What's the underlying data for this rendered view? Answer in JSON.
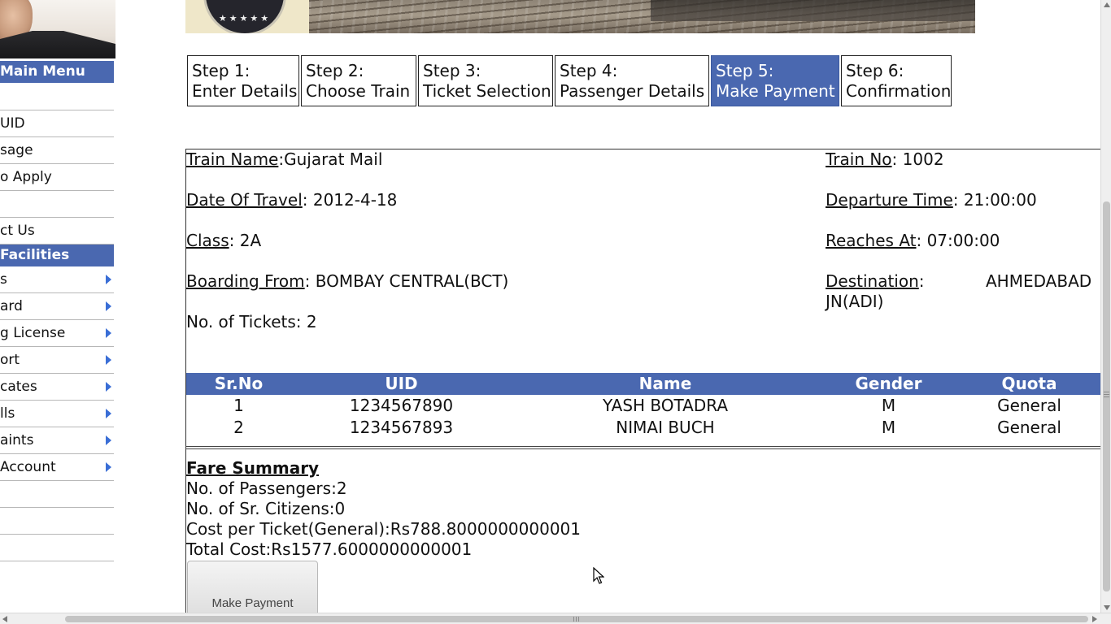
{
  "sidebar": {
    "main_menu_title": "Main Menu",
    "main_items": [
      {
        "label": ""
      },
      {
        "label": "UID"
      },
      {
        "label": "sage"
      },
      {
        "label": "o Apply"
      },
      {
        "label": ""
      },
      {
        "label": "ct Us"
      }
    ],
    "facilities_title": " Facilities",
    "facility_items": [
      {
        "label": "s"
      },
      {
        "label": "ard"
      },
      {
        "label": "g License"
      },
      {
        "label": "ort"
      },
      {
        "label": "cates"
      },
      {
        "label": "lls"
      },
      {
        "label": "aints"
      },
      {
        "label": " Account"
      },
      {
        "label": ""
      },
      {
        "label": ""
      },
      {
        "label": ""
      }
    ]
  },
  "steps": [
    {
      "number": "Step 1:",
      "label": "Enter Details"
    },
    {
      "number": "Step 2:",
      "label": "Choose Train"
    },
    {
      "number": "Step 3:",
      "label": "Ticket Selection"
    },
    {
      "number": "Step 4:",
      "label": "Passenger Details"
    },
    {
      "number": "Step 5:",
      "label": "Make Payment"
    },
    {
      "number": "Step 6:",
      "label": "Confirmation"
    }
  ],
  "details": {
    "train_name_label": "Train Name",
    "train_name_value": ":Gujarat Mail",
    "train_no_label": "Train No",
    "train_no_value": ": 1002",
    "date_label": "Date Of Travel",
    "date_value": ": 2012-4-18",
    "departure_label": "Departure Time",
    "departure_value": ": 21:00:00",
    "class_label": "Class",
    "class_value": ": 2A",
    "reaches_label": "Reaches At",
    "reaches_value": ": 07:00:00",
    "boarding_label": "Boarding From",
    "boarding_value": ": BOMBAY CENTRAL(BCT)",
    "destination_label": "Destination",
    "destination_colon": ":",
    "destination_value_1": "AHMEDABAD",
    "destination_value_2": "JN(ADI)",
    "tickets_text": "No. of Tickets: 2"
  },
  "passenger_table": {
    "headers": [
      "Sr.No",
      "UID",
      "Name",
      "Gender",
      "Quota"
    ],
    "rows": [
      [
        "1",
        "1234567890",
        "YASH BOTADRA",
        "M",
        "General"
      ],
      [
        "2",
        "1234567893",
        "NIMAI BUCH",
        "M",
        "General"
      ]
    ]
  },
  "fare": {
    "title": "Fare Summary",
    "passengers": "No. of Passengers:2",
    "sr_citizens": "No. of Sr. Citizens:0",
    "cost_per_ticket": "Cost per Ticket(General):Rs788.8000000000001",
    "total_cost": "Total Cost:Rs1577.6000000000001"
  },
  "make_payment_button": "Make Payment",
  "colors": {
    "accent": "#4a68b0",
    "arrow": "#3a6ed6"
  }
}
